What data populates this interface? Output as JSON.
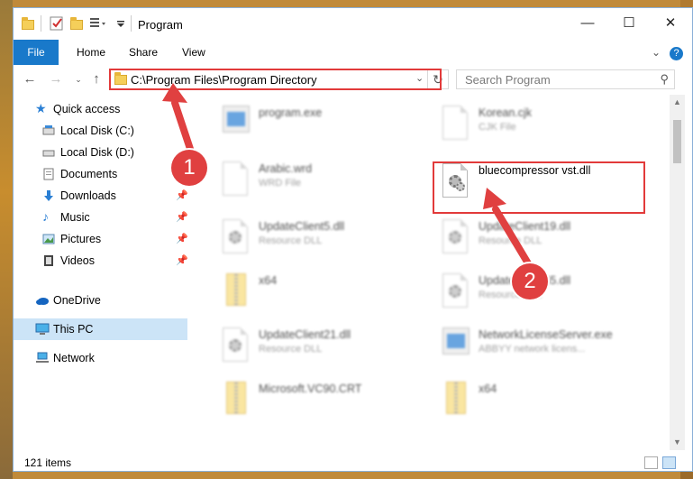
{
  "window": {
    "title": "Program"
  },
  "ribbon": {
    "tabs": [
      "File",
      "Home",
      "Share",
      "View"
    ]
  },
  "address": {
    "path": "C:\\Program Files\\Program Directory",
    "search_placeholder": "Search Program"
  },
  "sidebar": {
    "items": [
      {
        "label": "Quick access",
        "icon": "star-icon"
      },
      {
        "label": "Local Disk (C:)",
        "icon": "drive-icon"
      },
      {
        "label": "Local Disk (D:)",
        "icon": "drive-icon"
      },
      {
        "label": "Documents",
        "icon": "documents-icon"
      },
      {
        "label": "Downloads",
        "icon": "download-icon"
      },
      {
        "label": "Music",
        "icon": "music-icon"
      },
      {
        "label": "Pictures",
        "icon": "pictures-icon"
      },
      {
        "label": "Videos",
        "icon": "videos-icon"
      },
      {
        "label": "OneDrive",
        "icon": "cloud-icon"
      },
      {
        "label": "This PC",
        "icon": "computer-icon"
      },
      {
        "label": "Network",
        "icon": "network-icon"
      }
    ]
  },
  "files": [
    {
      "name": "program.exe",
      "sub": ""
    },
    {
      "name": "Korean.cjk",
      "sub": "CJK File"
    },
    {
      "name": "Arabic.wrd",
      "sub": "WRD File"
    },
    {
      "name": "bluecompressor vst.dll",
      "sub": ""
    },
    {
      "name": "UpdateClient5.dll",
      "sub": "Resource DLL"
    },
    {
      "name": "UpdateClient19.dll",
      "sub": "Resource DLL"
    },
    {
      "name": "x64",
      "sub": ""
    },
    {
      "name": "UpdateClient65.dll",
      "sub": "Resource DLL"
    },
    {
      "name": "UpdateClient21.dll",
      "sub": "Resource DLL"
    },
    {
      "name": "NetworkLicenseServer.exe",
      "sub": "ABBYY network licens..."
    },
    {
      "name": "Microsoft.VC90.CRT",
      "sub": ""
    },
    {
      "name": "x64",
      "sub": ""
    }
  ],
  "status": {
    "count": "121 items"
  },
  "callouts": {
    "one": "1",
    "two": "2"
  },
  "colors": {
    "accent": "#1979ca",
    "highlight": "#e23a3a",
    "selected": "#cce4f7"
  }
}
